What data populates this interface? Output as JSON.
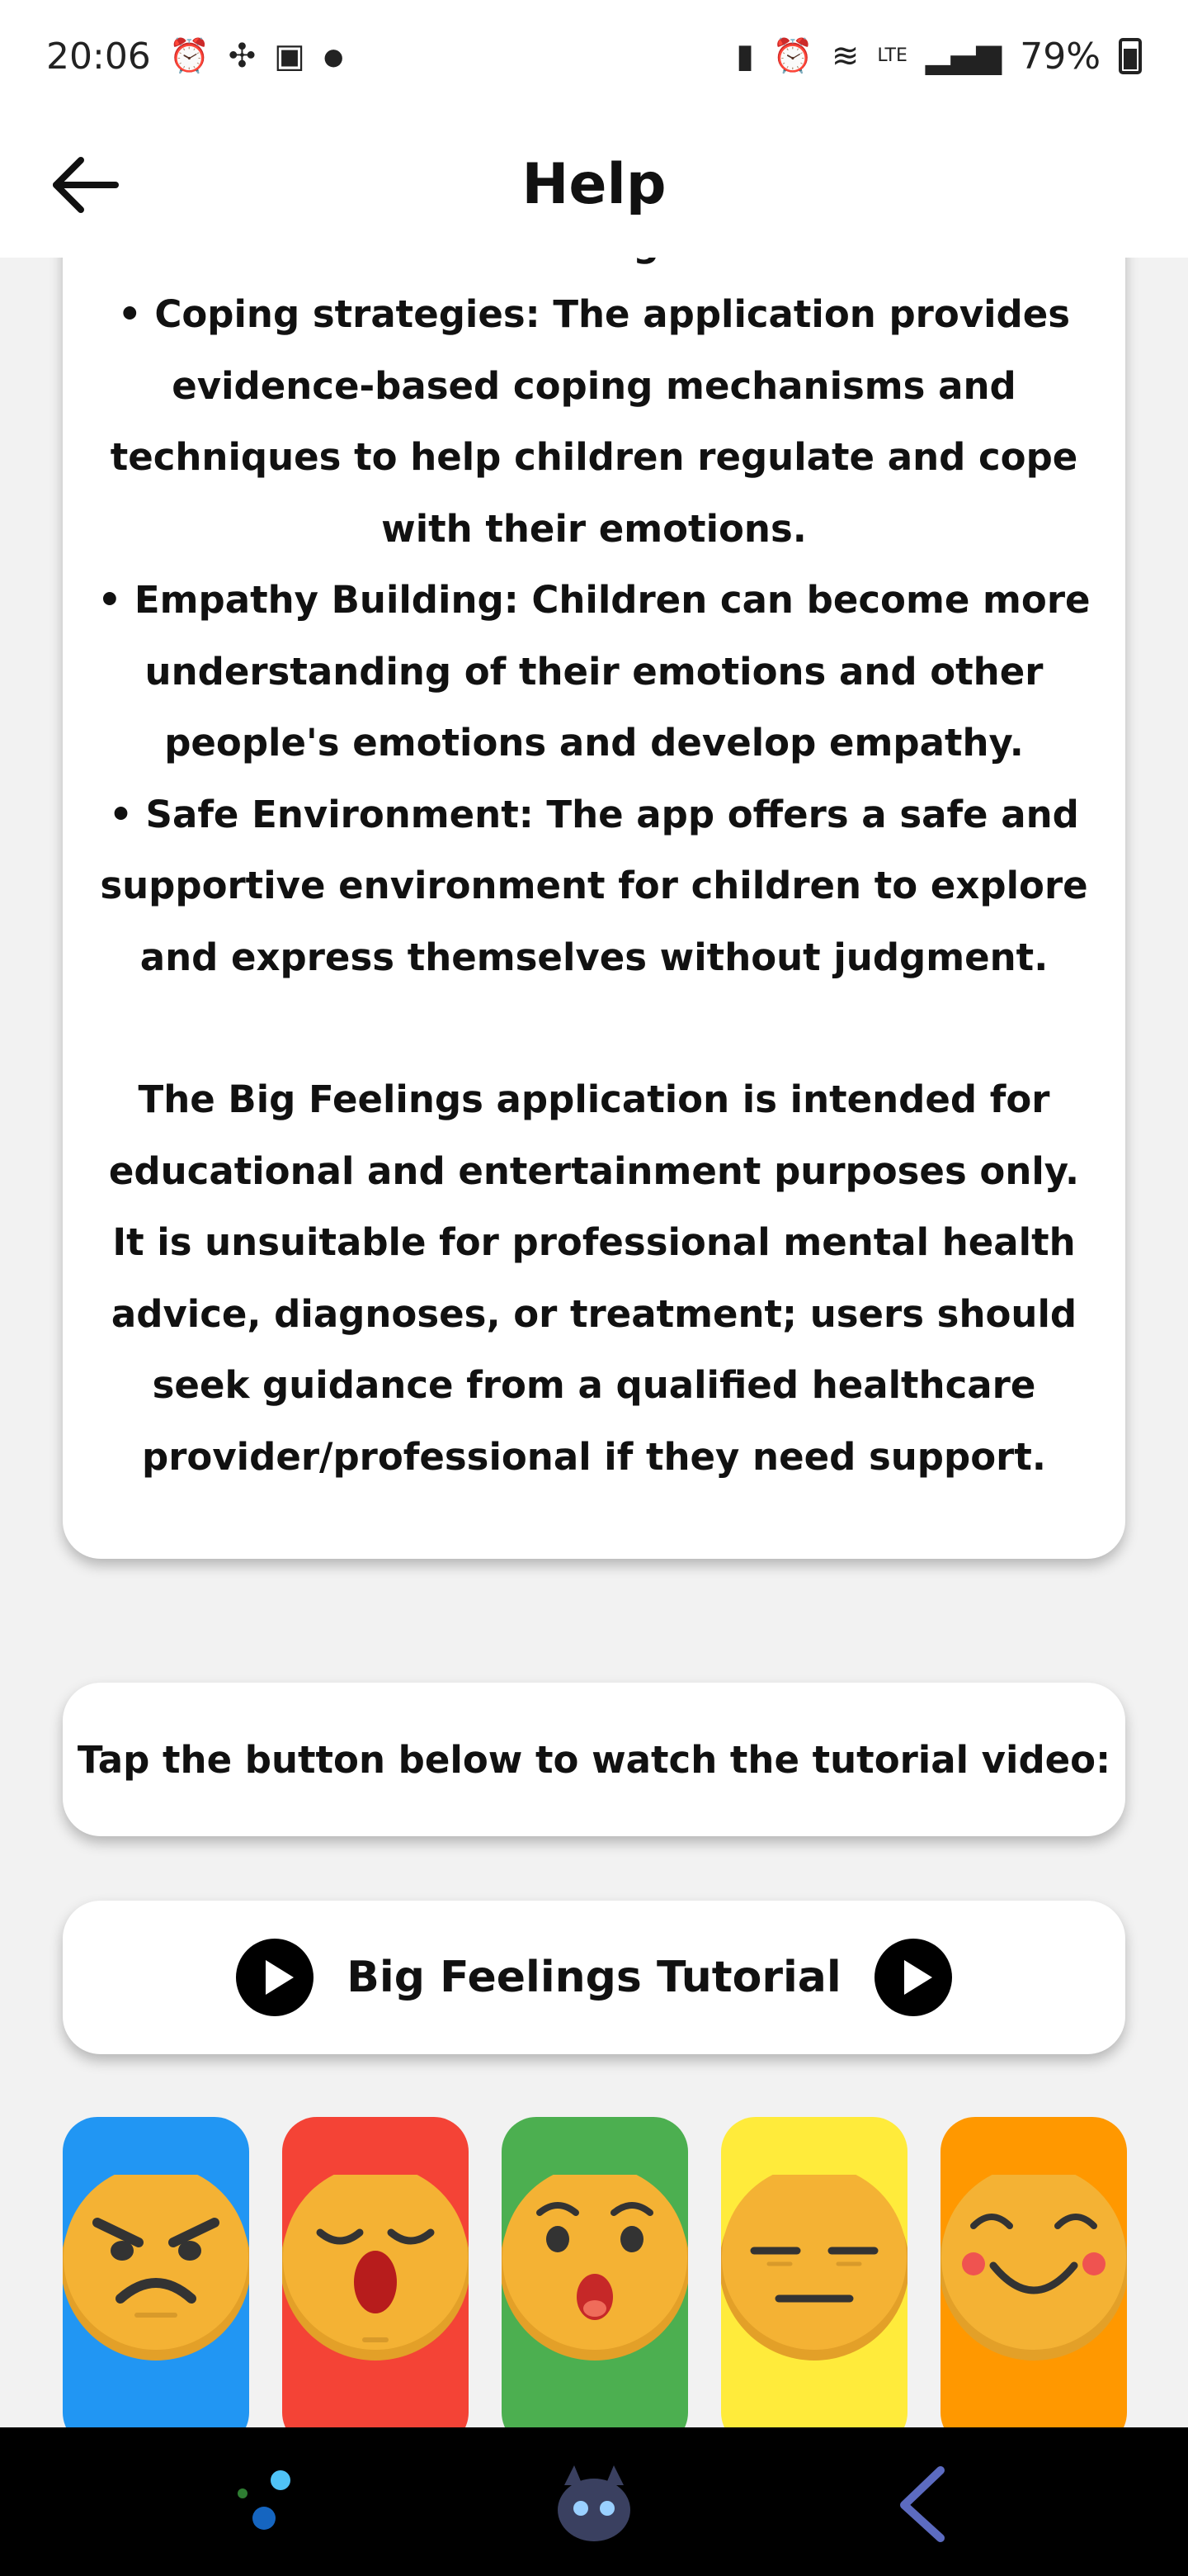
{
  "status_bar": {
    "time": "20:06",
    "battery": "79%"
  },
  "app_bar": {
    "title": "Help"
  },
  "info": {
    "partial_top": "feeling.",
    "bullets": [
      "• Coping strategies: The application provides evidence-based coping mechanisms and techniques to help children regulate and cope with their emotions.",
      "• Empathy Building: Children can become more understanding of their emotions and other people's emotions and develop empathy.",
      "• Safe Environment: The app offers a safe and supportive environment for children to explore and express themselves without judgment."
    ],
    "disclaimer": "The Big Feelings application is intended for educational and entertainment purposes only. It is unsuitable for professional mental health advice, diagnoses, or treatment; users should seek guidance from a qualified healthcare provider/professional if they need support."
  },
  "tutorial": {
    "prompt": "Tap the button below to watch the tutorial video:",
    "button_label": "Big Feelings Tutorial"
  },
  "emotions": [
    {
      "name": "angry",
      "color": "#2196f3"
    },
    {
      "name": "tired",
      "color": "#f44336"
    },
    {
      "name": "surprised",
      "color": "#4caf50"
    },
    {
      "name": "neutral",
      "color": "#ffeb3b"
    },
    {
      "name": "happy",
      "color": "#ff9800"
    }
  ],
  "colors": {
    "face": "#f4b234",
    "face_shadow": "#e3a028"
  },
  "nav_icons": [
    "app-icon",
    "dragon-avatar-icon",
    "back-gesture-icon"
  ]
}
